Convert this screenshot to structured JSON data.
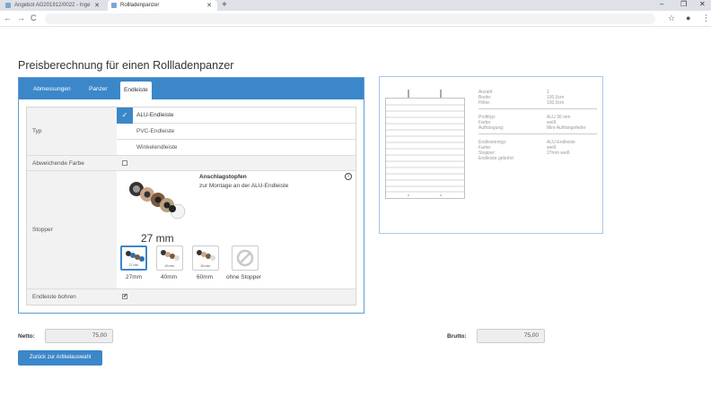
{
  "browser": {
    "tabs": [
      {
        "title": "Angebot AG201912/0022 - Inge"
      },
      {
        "title": "Rollladenpanzer"
      }
    ],
    "new_tab": "+",
    "window": {
      "minimize": "–",
      "restore": "❐",
      "close": "✕"
    }
  },
  "page": {
    "title": "Preisberechnung für einen Rollladenpanzer"
  },
  "tabs": [
    "Abmessungen",
    "Panzer",
    "Endleiste"
  ],
  "form": {
    "typ_label": "Typ",
    "typ_options": [
      {
        "label": "ALU-Endleiste",
        "selected": true
      },
      {
        "label": "PVC-Endleiste",
        "selected": false
      },
      {
        "label": "Winkelendleiste",
        "selected": false
      }
    ],
    "farbe_label": "Abweichende Farbe",
    "stopper_label": "Stopper",
    "stopper_title": "Anschlagstopfen",
    "stopper_desc": "zur Montage an der ALU-Endleiste",
    "stopper_size": "27 mm",
    "stopper_options": [
      {
        "label": "27mm",
        "mm": "27 mm",
        "selected": true
      },
      {
        "label": "40mm",
        "mm": "40 mm",
        "selected": false
      },
      {
        "label": "60mm",
        "mm": "60 mm",
        "selected": false
      },
      {
        "label": "ohne Stopper",
        "mm": "",
        "selected": false
      }
    ],
    "bohren_label": "Endleiste bohren",
    "bohren_checked": "✔"
  },
  "preview": {
    "rows": [
      {
        "k": "Anzahl:",
        "v": "1"
      },
      {
        "k": "Breite:",
        "v": "100,0cm"
      },
      {
        "k": "Höhe:",
        "v": "100,0cm"
      },
      {
        "k": "Profiltyp:",
        "v": "ALU 36 mm"
      },
      {
        "k": "Farbe:",
        "v": "weiß"
      },
      {
        "k": "Aufhängung:",
        "v": "Mini-Aufhängefeder"
      },
      {
        "k": "Endleistentyp:",
        "v": "ALU-Endleiste"
      },
      {
        "k": "Farbe:",
        "v": "weiß"
      },
      {
        "k": "Stopper:",
        "v": "27mm weiß"
      },
      {
        "k": "Endleiste gebohrt",
        "v": ""
      }
    ]
  },
  "totals": {
    "netto_label": "Netto:",
    "netto_value": "75,00",
    "brutto_label": "Brutto:",
    "brutto_value": "75,00"
  },
  "back_button": "Zurück zur Artikelauswahl"
}
